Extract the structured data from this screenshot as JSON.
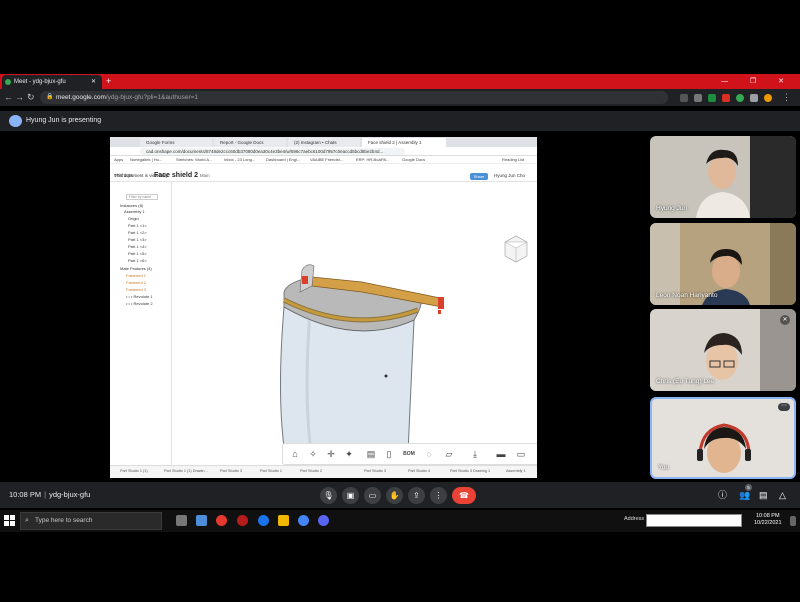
{
  "browser": {
    "tab_title": "Meet - ydg-bjux-gfu",
    "new_tab": "+",
    "window_controls": "— ❐ ✕",
    "url_host": "meet.google.com",
    "url_path": "/ydg-bjux-gfu?pli=1&authuser=1",
    "icons": [
      "back-icon",
      "forward-icon",
      "reload-icon",
      "lock-icon",
      "extensions-icon",
      "menu-icon"
    ]
  },
  "meet": {
    "presenting_text": "Hyung Jun is presenting",
    "time": "10:08 PM",
    "meeting_code": "ydg-bjux-gfu",
    "participant_count": "5",
    "participants": [
      {
        "name": "Hyung Jun"
      },
      {
        "name": "Leon Noah Hariyanto"
      },
      {
        "name": "Chris (Eu Tung) Lee"
      },
      {
        "name": "You"
      }
    ],
    "controls": [
      "mic-icon",
      "camera-icon",
      "captions-icon",
      "raise-hand-icon",
      "present-icon",
      "more-options-icon",
      "end-call-icon"
    ],
    "right_controls": [
      "info-icon",
      "people-icon",
      "chat-icon",
      "activities-icon"
    ],
    "colors": {
      "top_bar": "#d0121b",
      "hangup": "#ea4335",
      "bg": "#202124"
    }
  },
  "shared_screen": {
    "tabs": [
      "Google Forms",
      "Report - Google Docs",
      "(2) Instagram • Chats",
      "Face shield 2 | Assembly 1"
    ],
    "url": "cad.onshape.com/documents/8748de2ccc60db37080d0ea30c4e3be4/w/596c7aebc6100d7957c0eaccd5bcd8be2b4d...",
    "bookmarks": [
      "Apps",
      "Nortegaltek | Hu...",
      "Stretches: World A...",
      "Inbox - 23 Long...",
      "Dashboard | Engl...",
      "VAAIBE Friendst...",
      "ERP: HR-BoAPA...",
      "Google Docs",
      "Reading List"
    ],
    "app_logo": "onshape",
    "doc_title": "Face shield 2",
    "doc_sub": "Main",
    "share_label": "Share",
    "user_label": "Hyung Jun Cho",
    "view_only": "This document is view only.",
    "filter_placeholder": "Filter by name",
    "tree": {
      "instances": "Instances (8)",
      "assembly": "Assembly 1",
      "origin": "Origin",
      "parts": [
        "Part 1 <1>",
        "Part 1 <2>",
        "Part 1 <3>",
        "Part 1 <4>",
        "Part 1 <5>",
        "Part 1 <6>"
      ],
      "features_header": "Mate Features (4)",
      "features": [
        "Fastened 1",
        "Fastened 2",
        "Fastened 3"
      ],
      "extra": [
        "• • • Revolute 1",
        "• • • Revolute 2"
      ]
    },
    "toolbar_icons": [
      "home-icon",
      "explode-icon",
      "move-icon",
      "mate-icon",
      "section-icon",
      "document-icon",
      "bom-icon",
      "comment-icon",
      "export-icon",
      "print-icon",
      "layout-icon",
      "more-icon"
    ],
    "bom_label": "BOM",
    "bottom_tabs": [
      "Part Studio 1 (1)",
      "Part Studio 1 (1) Drawin...",
      "Part Studio 3",
      "Part Studio 1",
      "Part Studio 2",
      "Part Studio 3",
      "Part Studio 4",
      "Part Studio 3 Drawing 1",
      "Assembly 1"
    ]
  },
  "taskbar": {
    "search_placeholder": "Type here to search",
    "address_label": "Address",
    "time": "10:08 PM",
    "date": "10/22/2021"
  }
}
